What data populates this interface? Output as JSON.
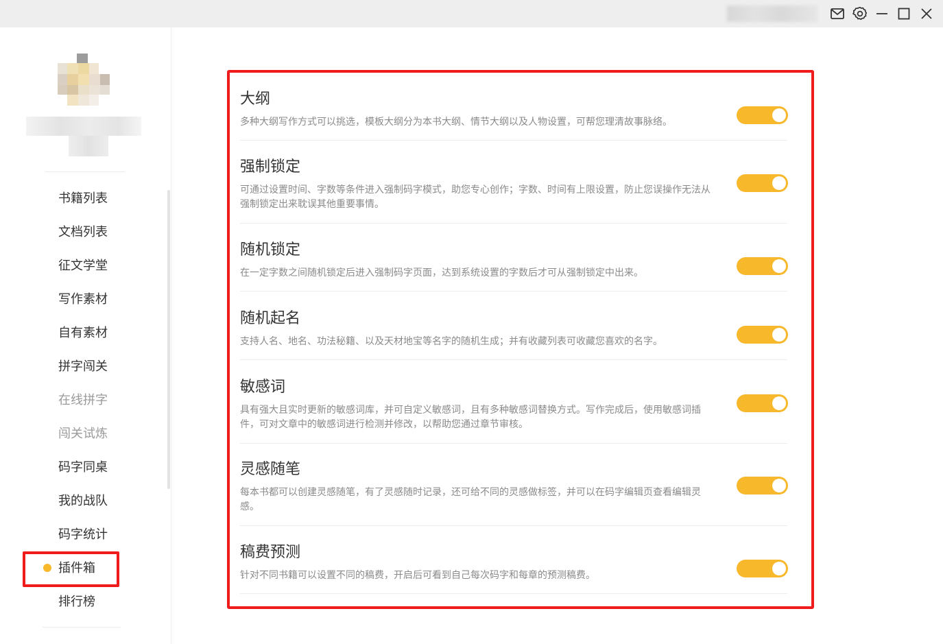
{
  "titlebar": {
    "icons": [
      "mail-icon",
      "settings-icon",
      "minimize-icon",
      "maximize-icon",
      "close-icon"
    ]
  },
  "sidebar": {
    "items": [
      {
        "label": "书籍列表",
        "state": "normal"
      },
      {
        "label": "文档列表",
        "state": "normal"
      },
      {
        "label": "征文学堂",
        "state": "normal"
      },
      {
        "label": "写作素材",
        "state": "normal"
      },
      {
        "label": "自有素材",
        "state": "normal"
      },
      {
        "label": "拼字闯关",
        "state": "normal"
      },
      {
        "label": "在线拼字",
        "state": "dim"
      },
      {
        "label": "闯关试炼",
        "state": "dim"
      },
      {
        "label": "码字同桌",
        "state": "normal"
      },
      {
        "label": "我的战队",
        "state": "normal"
      },
      {
        "label": "码字统计",
        "state": "normal"
      },
      {
        "label": "插件箱",
        "state": "active"
      },
      {
        "label": "排行榜",
        "state": "normal"
      }
    ],
    "active_dot_color": "#f8b82c"
  },
  "plugins": [
    {
      "title": "大纲",
      "description": "多种大纲写作方式可以挑选，模板大纲分为本书大纲、情节大纲以及人物设置，可帮您理清故事脉络。",
      "enabled": true
    },
    {
      "title": "强制锁定",
      "description": "可通过设置时间、字数等条件进入强制码字模式，助您专心创作；字数、时间有上限设置，防止您误操作无法从强制锁定出来耽误其他重要事情。",
      "enabled": true
    },
    {
      "title": "随机锁定",
      "description": "在一定字数之间随机锁定后进入强制码字页面，达到系统设置的字数后才可从强制锁定中出来。",
      "enabled": true
    },
    {
      "title": "随机起名",
      "description": "支持人名、地名、功法秘籍、以及天材地宝等名字的随机生成；并有收藏列表可收藏您喜欢的名字。",
      "enabled": true
    },
    {
      "title": "敏感词",
      "description": "具有强大且实时更新的敏感词库，并可自定义敏感词，且有多种敏感词替换方式。写作完成后，使用敏感词插件，可对文章中的敏感词进行检测并修改，以帮助您通过章节审核。",
      "enabled": true
    },
    {
      "title": "灵感随笔",
      "description": "每本书都可以创建灵感随笔，有了灵感随时记录，还可给不同的灵感做标签，并可以在码字编辑页查看编辑灵感。",
      "enabled": true
    },
    {
      "title": "稿费预测",
      "description": "针对不同书籍可以设置不同的稿费，开启后可看到自己每次码字和每章的预测稿费。",
      "enabled": true
    }
  ],
  "colors": {
    "toggle_on": "#f8b82c",
    "highlight_border": "#f01c1c"
  }
}
